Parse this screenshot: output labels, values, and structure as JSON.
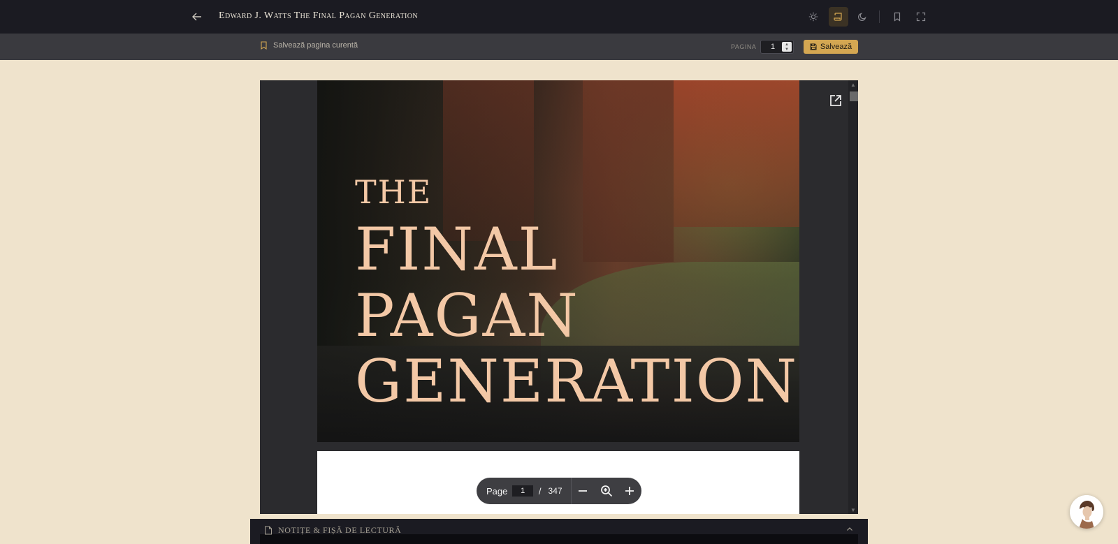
{
  "topbar": {
    "title": "Edward J. Watts The Final Pagan Generation",
    "active_color": "#d4a752"
  },
  "subbar": {
    "save_current_label": "Salvează pagina curentă",
    "page_label": "PAGINA",
    "page_value": "1",
    "save_button_label": "Salvează"
  },
  "viewer": {
    "cover": {
      "line1": "THE",
      "line2": "FINAL",
      "line3": "PAGAN",
      "line4": "GENERATION"
    },
    "pager": {
      "page_label": "Page",
      "current_page": "1",
      "separator": "/",
      "total_pages": "347"
    }
  },
  "notes": {
    "title": "NOTIȚE & FIȘĂ DE LECTURĂ"
  }
}
